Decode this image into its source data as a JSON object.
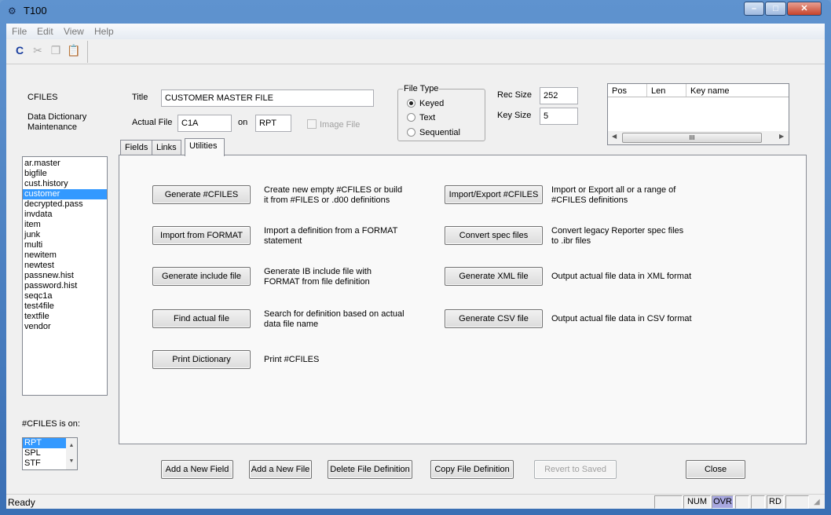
{
  "window": {
    "title": "T100"
  },
  "menu": [
    "File",
    "Edit",
    "View",
    "Help"
  ],
  "toolbar": {
    "icons": [
      "cfiles-icon",
      "cut-icon",
      "copy-icon",
      "paste-icon"
    ]
  },
  "app": {
    "name": "CFILES",
    "subtitle1": "Data Dictionary",
    "subtitle2": "Maintenance"
  },
  "form": {
    "title_label": "Title",
    "title_value": "CUSTOMER MASTER FILE",
    "actual_file_label": "Actual File",
    "actual_file_value": "C1A",
    "on_label": "on",
    "on_value": "RPT",
    "image_file_label": "Image File",
    "image_file_checked": false,
    "file_type": {
      "label": "File Type",
      "options": [
        "Keyed",
        "Text",
        "Sequential"
      ],
      "selected": "Keyed"
    },
    "rec_size_label": "Rec Size",
    "rec_size_value": "252",
    "key_size_label": "Key Size",
    "key_size_value": "5"
  },
  "keys_table": {
    "columns": [
      "Pos",
      "Len",
      "Key name"
    ],
    "rows": []
  },
  "tabs": [
    {
      "label": "Fields"
    },
    {
      "label": "Links"
    },
    {
      "label": "Utilities",
      "active": true
    }
  ],
  "files": [
    "ar.master",
    "bigfile",
    "cust.history",
    "customer",
    "decrypted.pass",
    "invdata",
    "item",
    "junk",
    "multi",
    "newitem",
    "newtest",
    "passnew.hist",
    "password.hist",
    "seqc1a",
    "test4file",
    "textfile",
    "vendor"
  ],
  "selected_file": "customer",
  "cfiles_on": {
    "label": "#CFILES is on:",
    "options": [
      "RPT",
      "SPL",
      "STF"
    ],
    "selected": "RPT"
  },
  "utilities_left": [
    {
      "button": "Generate #CFILES",
      "desc1": "Create new empty #CFILES or build",
      "desc2": "it from #FILES or .d00 definitions"
    },
    {
      "button": "Import from FORMAT",
      "desc1": "Import a definition from a FORMAT",
      "desc2": "statement"
    },
    {
      "button": "Generate include file",
      "desc1": "Generate IB include file with",
      "desc2": "FORMAT from file definition"
    },
    {
      "button": "Find actual file",
      "desc1": "Search for definition based on actual",
      "desc2": "data file name"
    },
    {
      "button": "Print Dictionary",
      "desc1": "Print #CFILES",
      "desc2": ""
    }
  ],
  "utilities_right": [
    {
      "button": "Import/Export #CFILES",
      "desc1": "Import or Export all or a range of",
      "desc2": "#CFILES definitions"
    },
    {
      "button": "Convert spec files",
      "desc1": "Convert legacy Reporter spec files",
      "desc2": "to .ibr files"
    },
    {
      "button": "Generate XML file",
      "desc1": "Output actual file data in XML format",
      "desc2": ""
    },
    {
      "button": "Generate CSV file",
      "desc1": "Output actual file data in CSV format",
      "desc2": ""
    }
  ],
  "bottom_buttons": {
    "add_field": "Add a New Field",
    "add_file": "Add a New File",
    "delete": "Delete File Definition",
    "copy": "Copy File Definition",
    "revert": "Revert to Saved",
    "close": "Close"
  },
  "status": {
    "text": "Ready",
    "num": "NUM",
    "ovr": "OVR",
    "rd": "RD"
  },
  "colors": {
    "selection": "#3399ff",
    "ovr_highlight": "#a8a8e0"
  }
}
